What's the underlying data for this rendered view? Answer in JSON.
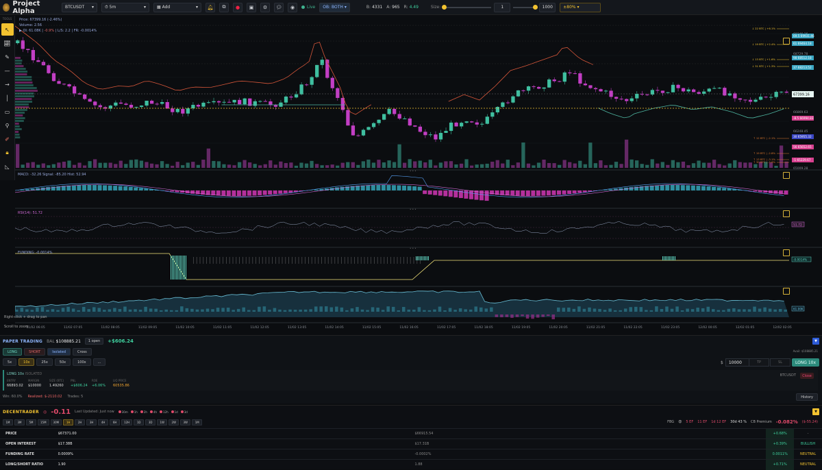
{
  "topbar": {
    "app_name": "Project Alpha",
    "symbol": "BTCUSDT",
    "interval": "5m",
    "add_label": "Add",
    "live_label": "Live",
    "ob_label": "OB: BOTH",
    "stat_b_label": "B:",
    "stat_b": "4331",
    "stat_a_label": "A:",
    "stat_a": "965",
    "stat_r_label": "R:",
    "stat_r": "4.49",
    "size_label": "Size:",
    "size_min": "1",
    "size_max": "1000",
    "pct": "±80%"
  },
  "tools": {
    "label": "TOOLS",
    "items": [
      "cursor-icon",
      "trend-icon",
      "pencil-icon",
      "hline-icon",
      "arrow-icon",
      "vline-icon",
      "rect-icon",
      "brush-icon",
      "ruler-icon",
      "lock-icon",
      "measure-icon"
    ]
  },
  "chart": {
    "price_line": "Price: 67399.16 (-2.46%)",
    "volume_line": "Volume: 2.56",
    "oi_line": "OI: 61.08K",
    "oi_chg": "-0.9%",
    "ls_line": "L/S: 2.2",
    "fr_line": "FR: -0.0014%",
    "current_price": "67399.16",
    "price_axis": [
      "69346.36",
      "68729.78",
      "67399.16",
      "66869.63",
      "66248.45",
      "65009.28"
    ],
    "right_tags": [
      {
        "label": "69.5 69931.46",
        "color": "#3aa7c4"
      },
      {
        "label": "61 69464.18",
        "color": "#3aa7c4"
      },
      {
        "label": "98 68512.18",
        "color": "#3aa7c4"
      },
      {
        "label": "37 68213.52",
        "color": "#3aa7c4"
      },
      {
        "label": "-8.5 66994.83",
        "color": "#d8408f"
      },
      {
        "label": "30 65955.32",
        "color": "#3a46c4"
      },
      {
        "label": "56 65652.65",
        "color": "#d8408f"
      },
      {
        "label": "-1 65229.67",
        "color": "#d8408f"
      }
    ],
    "level_labels": [
      "↓ 22 BTC | +6.1%",
      "↓ 19 BTC | +2.4%",
      "↓ 13 BTC | +1.6%",
      "↓ 31 BTC | +1.3%",
      "↑ 12 BTC | -2.1%",
      "↑ 19 BTC | -2.8%",
      "↑ 13 BTC | -3.1%",
      "↑ 30 BTC | -3.6%"
    ],
    "macd_label": "MACD: -32.26  Signal: -85.20  Hist: 52.94",
    "rsi_label": "RSI(14): 51.72",
    "rsi_value": "51.72",
    "funding_label": "FUNDING: -0.0014%",
    "funding_value": "-0.0014%",
    "cvd_value": "61.00K",
    "hint_pan": "Right-click + drag to pan",
    "hint_zoom": "Scroll to zoom",
    "time_ticks": [
      "11/02 06:05",
      "11/02 07:05",
      "11/02 08:05",
      "11/02 09:05",
      "11/02 10:05",
      "11/02 11:05",
      "11/02 12:05",
      "11/02 13:05",
      "11/02 14:05",
      "11/02 15:05",
      "11/02 16:05",
      "11/02 17:05",
      "11/02 18:05",
      "11/02 19:05",
      "11/02 20:05",
      "11/02 21:05",
      "11/02 22:05",
      "11/02 23:05",
      "12/02 00:05",
      "12/02 01:05",
      "12/02 02:05"
    ]
  },
  "paper": {
    "title": "PAPER TRADING",
    "bal_label": "BAL",
    "balance": "$108885.21",
    "open_count": "1 open",
    "pnl": "+$606.24",
    "long": "LONG",
    "short": "SHORT",
    "isolated": "Isolated",
    "cross": "Cross",
    "leverages": [
      "5x",
      "10x",
      "25x",
      "50x",
      "100x",
      "..."
    ],
    "avail": "Avail: $108885.21",
    "amount_prefix": "$",
    "amount": "10000",
    "tp": "TP",
    "sl": "SL",
    "long_btn": "LONG 10x",
    "position": {
      "title": "LONG 10x",
      "mode": "ISOLATED",
      "symbol": "BTCUSDT",
      "close": "Close",
      "cols": [
        {
          "k": "ENTRY",
          "v": "66893.02"
        },
        {
          "k": "MARGIN",
          "v": "$10000"
        },
        {
          "k": "SIZE (BTC)",
          "v": "1.49260"
        },
        {
          "k": "PNL",
          "v": "+$606.24"
        },
        {
          "k": "ROE",
          "v": "+6.06%"
        },
        {
          "k": "LIQ PRICE",
          "v": "60535.86"
        }
      ]
    },
    "win": "Win: 60.0%",
    "realized": "Realized: $-2110.02",
    "trades": "Trades: 5",
    "history": "History"
  },
  "dt": {
    "title": "DECENTRADER",
    "score": "-0.11",
    "updated": "Last Updated: Just now",
    "tf_dots": [
      "30m",
      "1h",
      "2h",
      "4h",
      "12h",
      "1d",
      "3d"
    ],
    "timeframes": [
      "1M",
      "3M",
      "5M",
      "15M",
      "30M",
      "1H",
      "2H",
      "3H",
      "4H",
      "6H",
      "12H",
      "1D",
      "3D",
      "1W",
      "2W",
      "3W",
      "1M"
    ],
    "fbg": "FBG",
    "ef1": "5 EF",
    "ef2": "11 EF",
    "ef3": "1d 12 EF",
    "ef4": "30d 43 %",
    "cb_label": "CB Premium",
    "cb_value": "-0.082%",
    "cb_usd": "($-55.24)",
    "rows": [
      {
        "label": "PRICE",
        "val": "$67371.00",
        "prev": "$66915.54",
        "chg": "+0.68%",
        "sig": "-",
        "cls": "dash"
      },
      {
        "label": "OPEN INTEREST",
        "val": "$17.38B",
        "prev": "$17.31B",
        "chg": "+0.39%",
        "sig": "BULLISH",
        "cls": "bull"
      },
      {
        "label": "FUNDING RATE",
        "val": "0.0009%",
        "prev": "-0.0002%",
        "chg": "0.0011%",
        "sig": "NEUTRAL",
        "cls": "neut"
      },
      {
        "label": "LONG/SHORT RATIO",
        "val": "1.90",
        "prev": "1.88",
        "chg": "+0.71%",
        "sig": "NEUTRAL",
        "cls": "neut"
      }
    ]
  },
  "colors": {
    "bull": "#3fbfa0",
    "bear": "#c23ec4",
    "accent": "#f2c230",
    "bg": "#0b0d10"
  }
}
